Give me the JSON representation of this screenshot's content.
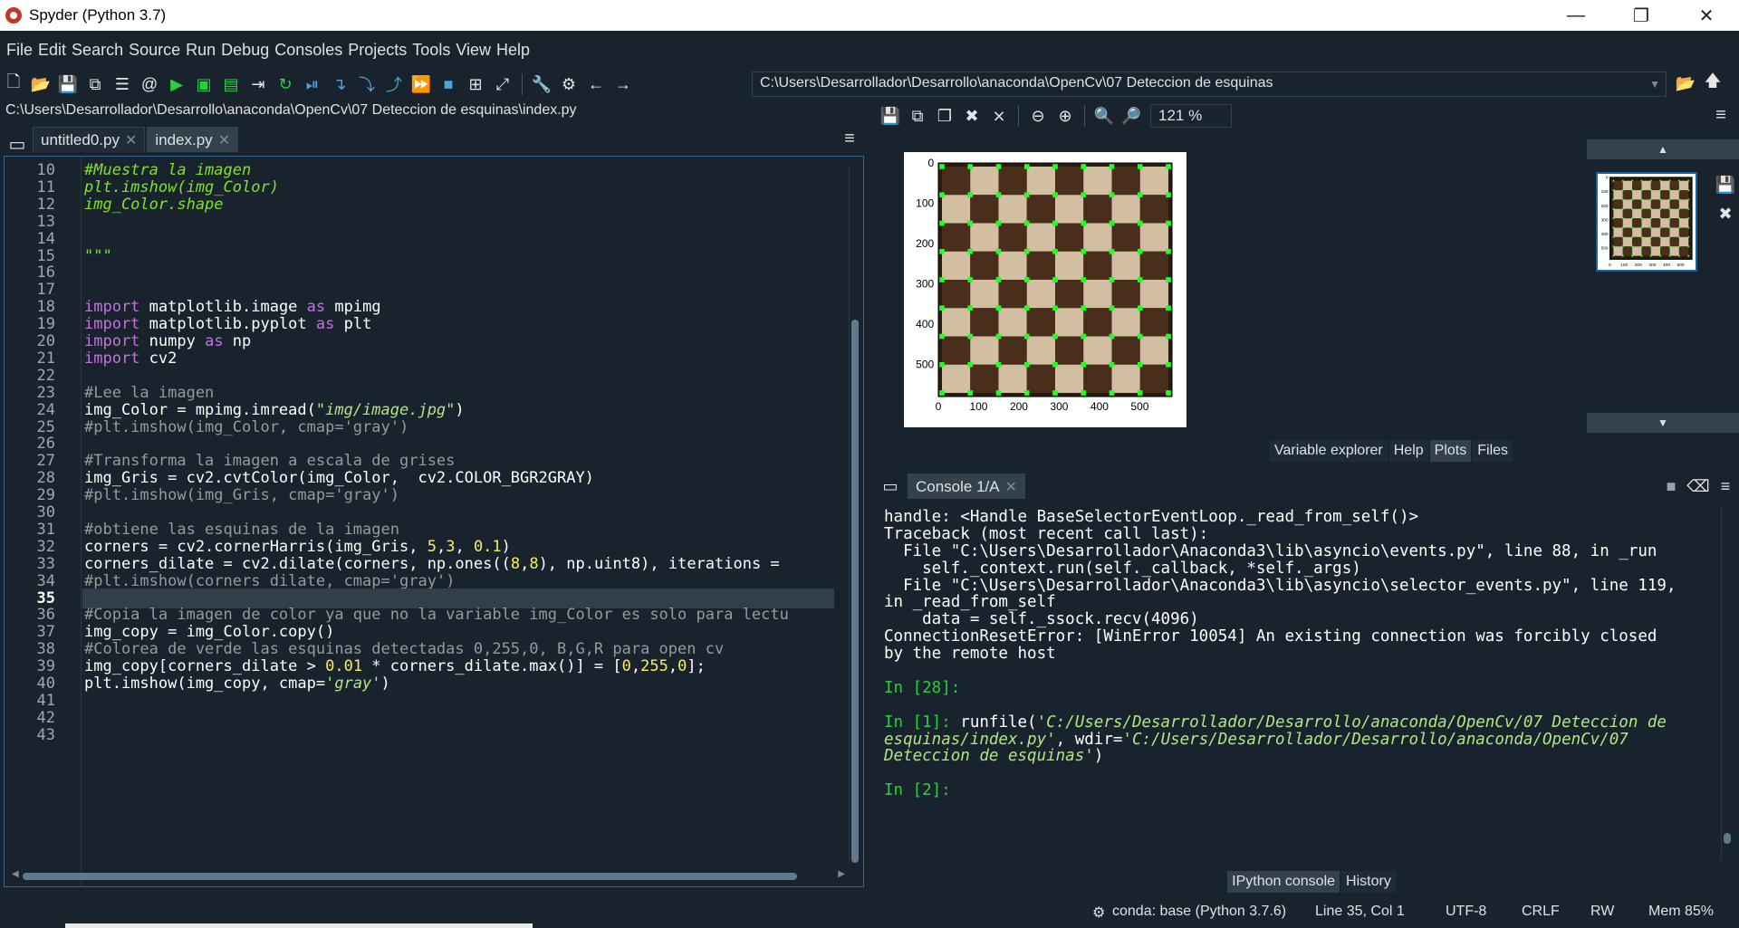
{
  "window": {
    "title": "Spyder (Python 3.7)",
    "min": "—",
    "max": "❐",
    "close": "✕"
  },
  "menu": [
    "File",
    "Edit",
    "Search",
    "Source",
    "Run",
    "Debug",
    "Consoles",
    "Projects",
    "Tools",
    "View",
    "Help"
  ],
  "toolbar": {
    "path": "C:\\Users\\Desarrollador\\Desarrollo\\anaconda\\OpenCv\\07 Deteccion de esquinas"
  },
  "editor": {
    "file_path": "C:\\Users\\Desarrollador\\Desarrollo\\anaconda\\OpenCv\\07 Deteccion de esquinas\\index.py",
    "tabs": [
      {
        "label": "untitled0.py",
        "active": false
      },
      {
        "label": "index.py",
        "active": true
      }
    ],
    "current_line": 35,
    "lines": [
      {
        "n": 10,
        "html": "<span class=\"cmi\">#Muestra la imagen</span>"
      },
      {
        "n": 11,
        "html": "<span class=\"cmi\">plt.imshow(img_Color)</span>"
      },
      {
        "n": 12,
        "html": "<span class=\"cmi\">img_Color.shape</span>"
      },
      {
        "n": 13,
        "html": ""
      },
      {
        "n": 14,
        "html": ""
      },
      {
        "n": 15,
        "html": "<span class=\"cmi\">\"\"\"</span>"
      },
      {
        "n": 16,
        "html": ""
      },
      {
        "n": 17,
        "html": ""
      },
      {
        "n": 18,
        "html": "<span class=\"kw\">import</span> matplotlib.image <span class=\"kw\">as</span> mpimg"
      },
      {
        "n": 19,
        "html": "<span class=\"kw\">import</span> matplotlib.pyplot <span class=\"kw\">as</span> plt"
      },
      {
        "n": 20,
        "html": "<span class=\"kw\">import</span> numpy <span class=\"kw\">as</span> np"
      },
      {
        "n": 21,
        "html": "<span class=\"kw\">import</span> cv2"
      },
      {
        "n": 22,
        "html": ""
      },
      {
        "n": 23,
        "html": "<span class=\"cm\">#Lee la imagen</span>"
      },
      {
        "n": 24,
        "html": "img_Color = mpimg.imread(<span class=\"str\">\"img/image.jpg\"</span>)"
      },
      {
        "n": 25,
        "html": "<span class=\"cm\">#plt.imshow(img_Color, cmap='gray')</span>"
      },
      {
        "n": 26,
        "html": ""
      },
      {
        "n": 27,
        "html": "<span class=\"cm\">#Transforma la imagen a escala de grises</span>"
      },
      {
        "n": 28,
        "html": "img_Gris = cv2.cvtColor(img_Color,  cv2.COLOR_BGR2GRAY)"
      },
      {
        "n": 29,
        "html": "<span class=\"cm\">#plt.imshow(img_Gris, cmap='gray')</span>"
      },
      {
        "n": 30,
        "html": ""
      },
      {
        "n": 31,
        "html": "<span class=\"cm\">#obtiene las esquinas de la imagen</span>"
      },
      {
        "n": 32,
        "html": "corners = cv2.cornerHarris(img_Gris, <span class=\"num\">5</span>,<span class=\"num\">3</span>, <span class=\"num\">0.1</span>)"
      },
      {
        "n": 33,
        "html": "corners_dilate = cv2.dilate(corners, np.ones((<span class=\"num\">8</span>,<span class=\"num\">8</span>), np.uint8), iterations ="
      },
      {
        "n": 34,
        "html": "<span class=\"cm\">#plt.imshow(corners_dilate, cmap='gray')</span>"
      },
      {
        "n": 35,
        "html": ""
      },
      {
        "n": 36,
        "html": "<span class=\"cm\">#Copia la imagen de color ya que no la variable img_Color es solo para lectu</span>"
      },
      {
        "n": 37,
        "html": "img_copy = img_Color.copy()"
      },
      {
        "n": 38,
        "html": "<span class=\"cm\">#Colorea de verde las esquinas detectadas 0,255,0, B,G,R para open cv</span>"
      },
      {
        "n": 39,
        "html": "img_copy[corners_dilate &gt; <span class=\"num\">0.01</span> * corners_dilate.max()] = [<span class=\"num\">0</span>,<span class=\"num\">255</span>,<span class=\"num\">0</span>];"
      },
      {
        "n": 40,
        "html": "plt.imshow(img_copy, cmap=<span class=\"str\">'gray'</span>)"
      },
      {
        "n": 41,
        "html": ""
      },
      {
        "n": 42,
        "html": ""
      },
      {
        "n": 43,
        "html": ""
      }
    ]
  },
  "plots": {
    "zoom": "121 %",
    "x_ticks": [
      "0",
      "100",
      "200",
      "300",
      "400",
      "500"
    ],
    "y_ticks": [
      "0",
      "100",
      "200",
      "300",
      "400",
      "500"
    ],
    "tabs": [
      {
        "label": "Variable explorer",
        "active": false
      },
      {
        "label": "Help",
        "active": false
      },
      {
        "label": "Plots",
        "active": true
      },
      {
        "label": "Files",
        "active": false
      }
    ]
  },
  "console": {
    "tab_label": "Console 1/A",
    "output": [
      {
        "t": "text",
        "s": "handle: <Handle BaseSelectorEventLoop._read_from_self()>"
      },
      {
        "t": "text",
        "s": "Traceback (most recent call last):"
      },
      {
        "t": "text",
        "s": "  File \"C:\\Users\\Desarrollador\\Anaconda3\\lib\\asyncio\\events.py\", line 88, in _run"
      },
      {
        "t": "text",
        "s": "    self._context.run(self._callback, *self._args)"
      },
      {
        "t": "text",
        "s": "  File \"C:\\Users\\Desarrollador\\Anaconda3\\lib\\asyncio\\selector_events.py\", line 119,"
      },
      {
        "t": "text",
        "s": "in _read_from_self"
      },
      {
        "t": "text",
        "s": "    data = self._ssock.recv(4096)"
      },
      {
        "t": "text",
        "s": "ConnectionResetError: [WinError 10054] An existing connection was forcibly closed"
      },
      {
        "t": "text",
        "s": "by the remote host"
      },
      {
        "t": "text",
        "s": ""
      },
      {
        "t": "prompt",
        "s": "In [28]:"
      },
      {
        "t": "text",
        "s": ""
      },
      {
        "t": "run1",
        "p": "In [1]: ",
        "a": "runfile(",
        "b": "'C:/Users/Desarrollador/Desarrollo/anaconda/OpenCv/07 Deteccion de"
      },
      {
        "t": "run2",
        "b": "esquinas/index.py'",
        "a": ", wdir=",
        "c": "'C:/Users/Desarrollador/Desarrollo/anaconda/OpenCv/07"
      },
      {
        "t": "run3",
        "b": "Deteccion de esquinas'",
        "a": ")"
      },
      {
        "t": "text",
        "s": ""
      },
      {
        "t": "prompt",
        "s": "In [2]:"
      }
    ],
    "tabs": [
      {
        "label": "IPython console",
        "active": true
      },
      {
        "label": "History",
        "active": false
      }
    ]
  },
  "status": {
    "conda": "conda: base (Python 3.7.6)",
    "position": "Line 35, Col 1",
    "encoding": "UTF-8",
    "eol": "CRLF",
    "perm": "RW",
    "mem": "Mem 85%"
  },
  "colors": {
    "background": "#19232d",
    "border": "#32414b",
    "accent": "#1464a0",
    "prompt_green": "#2ecc40",
    "corner_marker": "#22ff22"
  }
}
